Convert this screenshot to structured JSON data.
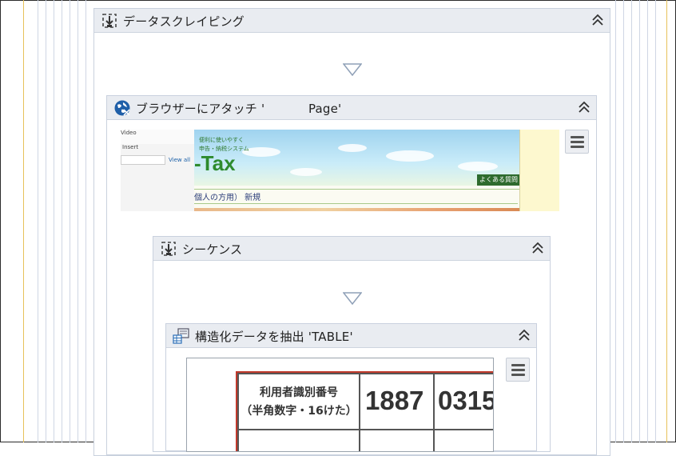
{
  "scraping": {
    "title": "データスクレイピング",
    "icon": "data-scraping-icon"
  },
  "attach_browser": {
    "title": "ブラウザーにアタッチ '           Page'",
    "icon": "globe-icon",
    "thumbnail": {
      "menu_video": "Video",
      "menu_insert": "Insert",
      "view_all": "View all",
      "tagline_1": "便利に使いやすく",
      "tagline_2": "申告・納税システム",
      "logo_text": "-Tax",
      "faq_button": "よくある質問",
      "nav_text": "個人の方用）  新規"
    }
  },
  "sequence": {
    "title": "シーケンス",
    "icon": "sequence-icon"
  },
  "extract": {
    "title": "構造化データを抽出 'TABLE'",
    "icon": "table-extract-icon",
    "table_preview": {
      "label_line1": "利用者識別番号",
      "label_line2": "（半角数字・16けた）",
      "value1": "1887",
      "value2": "0315"
    }
  },
  "colors": {
    "header_bg": "#e9ecf1",
    "border": "#c9d1de",
    "highlight_red": "#c0392b",
    "guide_gold": "#e7c25a"
  }
}
